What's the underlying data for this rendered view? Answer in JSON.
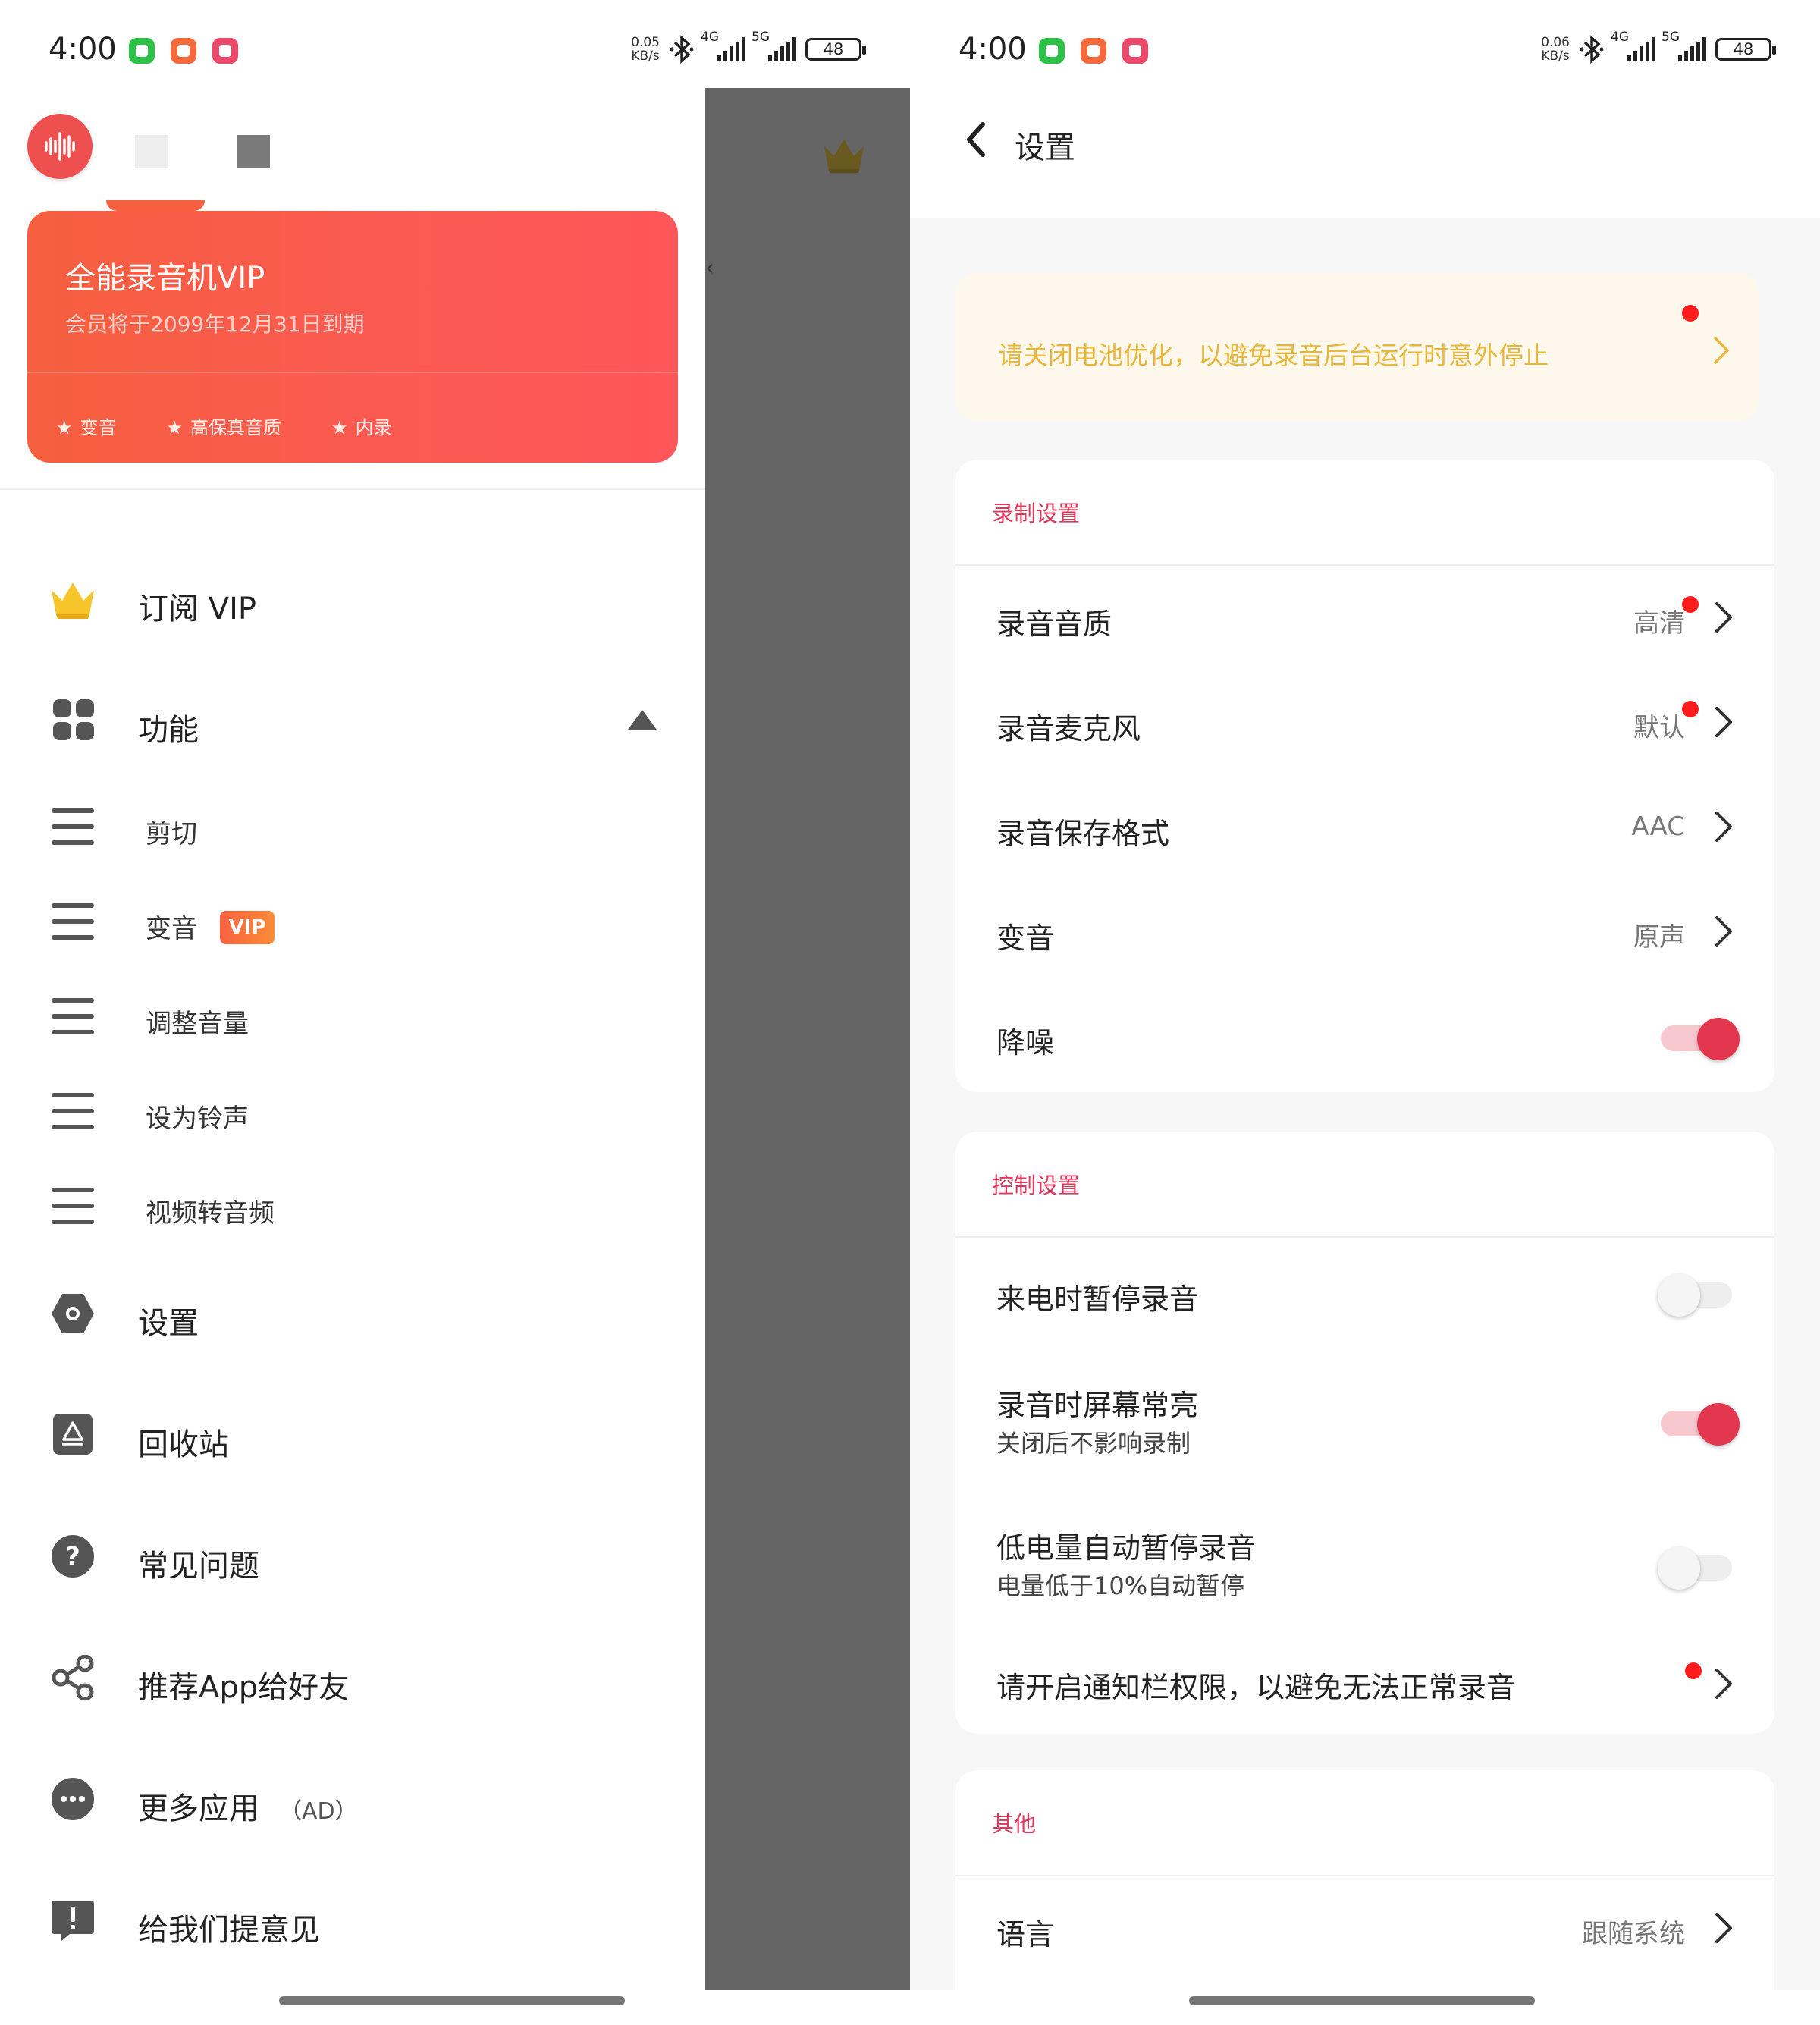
{
  "status_left": {
    "time": "4:00",
    "speed_value": "0.05",
    "speed_unit": "KB/s",
    "signal1": "4G",
    "signal2": "5G",
    "battery": "48"
  },
  "status_right": {
    "time": "4:00",
    "speed_value": "0.06",
    "speed_unit": "KB/s",
    "signal1": "4G",
    "signal2": "5G",
    "battery": "48"
  },
  "drawer": {
    "vip_card": {
      "title": "全能录音机VIP",
      "subtitle": "会员将于2099年12月31日到期",
      "features": [
        "变音",
        "高保真音质",
        "内录"
      ]
    },
    "subscribe_label": "订阅 VIP",
    "features_label": "功能",
    "sub_items": [
      {
        "label": "剪切"
      },
      {
        "label": "变音",
        "badge": "VIP"
      },
      {
        "label": "调整音量"
      },
      {
        "label": "设为铃声"
      },
      {
        "label": "视频转音频"
      }
    ],
    "settings_label": "设置",
    "recycle_label": "回收站",
    "faq_label": "常见问题",
    "share_label": "推荐App给好友",
    "more_apps_label": "更多应用",
    "more_apps_ad": "（AD）",
    "feedback_label": "给我们提意见",
    "overlay_fragment": "‹"
  },
  "settings": {
    "title": "设置",
    "notice": "请关闭电池优化，以避免录音后台运行时意外停止",
    "recording": {
      "section_title": "录制设置",
      "quality_label": "录音音质",
      "quality_value": "高清",
      "mic_label": "录音麦克风",
      "mic_value": "默认",
      "format_label": "录音保存格式",
      "format_value": "AAC",
      "voice_label": "变音",
      "voice_value": "原声",
      "noise_label": "降噪",
      "noise_on": true
    },
    "control": {
      "section_title": "控制设置",
      "pause_call_label": "来电时暂停录音",
      "pause_call_on": false,
      "screen_on_label": "录音时屏幕常亮",
      "screen_on_sub": "关闭后不影响录制",
      "screen_on_on": true,
      "low_battery_label": "低电量自动暂停录音",
      "low_battery_sub": "电量低于10%自动暂停",
      "low_battery_on": false,
      "notification_label": "请开启通知栏权限，以避免无法正常录音"
    },
    "other": {
      "section_title": "其他",
      "language_label": "语言",
      "language_value": "跟随系统"
    }
  },
  "colors": {
    "accent": "#e3374f",
    "vip_gradient_start": "#f65f3f",
    "vip_gradient_end": "#ff5659",
    "notice_text": "#e8b73a",
    "notice_bg": "#fdf8eb",
    "overlay": "#656565"
  }
}
